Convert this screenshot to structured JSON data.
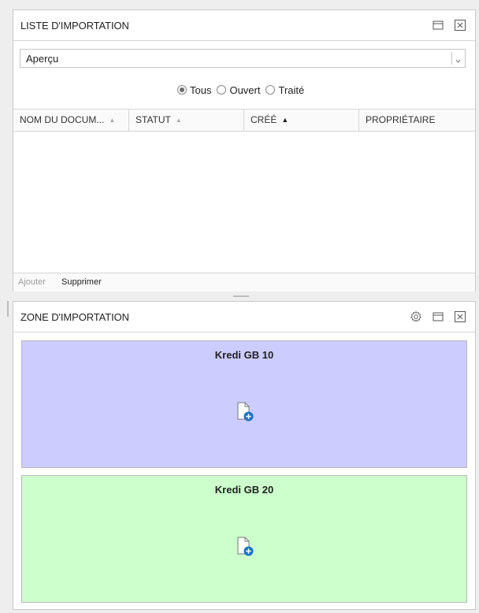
{
  "import_list": {
    "title": "LISTE D'IMPORTATION",
    "dropdown": {
      "value": "Aperçu"
    },
    "filters": [
      {
        "label": "Tous",
        "checked": true
      },
      {
        "label": "Ouvert",
        "checked": false
      },
      {
        "label": "Traité",
        "checked": false
      }
    ],
    "columns": [
      {
        "label": "NOM DU DOCUM...",
        "sort": "asc-inactive"
      },
      {
        "label": "STATUT",
        "sort": "asc-inactive"
      },
      {
        "label": "CRÉÉ",
        "sort": "asc-active"
      },
      {
        "label": "PROPRIÉTAIRE",
        "sort": "none"
      }
    ],
    "rows": [],
    "footer": {
      "add_label": "Ajouter",
      "delete_label": "Supprimer"
    }
  },
  "import_zone": {
    "title": "ZONE D'IMPORTATION",
    "zones": [
      {
        "label": "Kredi GB 10",
        "color": "#ccccff"
      },
      {
        "label": "Kredi GB 20",
        "color": "#ccffcc"
      }
    ]
  },
  "colors": {
    "accent": "#1a73c8"
  },
  "icons": [
    "maximize-icon",
    "close-icon",
    "settings-gear-icon",
    "chevron-down-icon",
    "document-add-icon"
  ]
}
